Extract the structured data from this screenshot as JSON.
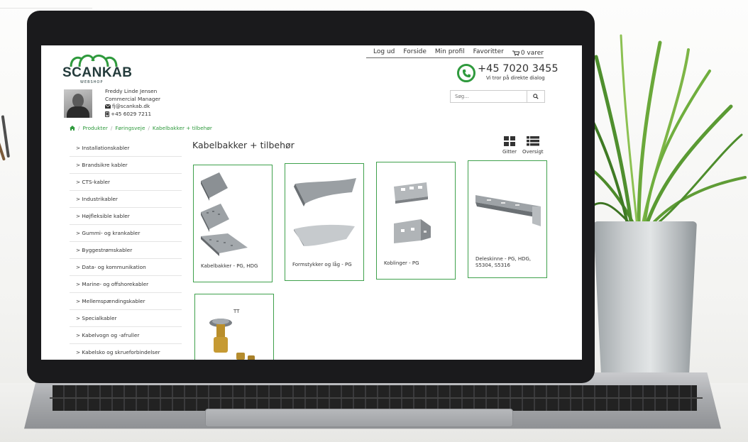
{
  "header": {
    "logo_text": "SCANKAB",
    "logo_sub": "WEBSHOP",
    "nav": [
      "Log ud",
      "Forside",
      "Min profil",
      "Favoritter",
      "0 varer"
    ],
    "phone": "+45 7020 3455",
    "phone_sub": "Vi tror på direkte dialog",
    "search_placeholder": "Søg..."
  },
  "contact": {
    "name": "Freddy Linde Jensen",
    "title": "Commercial Manager",
    "email": "fj@scankab.dk",
    "phone": "+45 6029 7211"
  },
  "breadcrumb": [
    "Produkter",
    "Føringsveje",
    "Kabelbakker + tilbehør"
  ],
  "sidebar": {
    "items": [
      "> Installationskabler",
      "> Brandsikre kabler",
      "> CTS-kabler",
      "> Industrikabler",
      "> Højfleksible kabler",
      "> Gummi- og krankabler",
      "> Byggestrømskabler",
      "> Data- og kommunikation",
      "> Marine- og offshorekabler",
      "> Mellemspændingskabler",
      "> Specialkabler",
      "> Kabelvogn og -afruller",
      "> Kabelsko og skrueforbindelser"
    ]
  },
  "main": {
    "title": "Kabelbakker + tilbehør",
    "view_grid": "Gitter",
    "view_list": "Oversigt",
    "products": [
      {
        "label": "Kabelbakker - PG, HDG"
      },
      {
        "label": "Formstykker og låg - PG"
      },
      {
        "label": "Koblinger - PG"
      },
      {
        "label": "Deleskinne - PG, HDG,",
        "label2": "S5304, S5316"
      }
    ]
  },
  "colors": {
    "accent": "#2f9a3d",
    "logo": "#233b3b"
  },
  "icons": [
    "phone-icon",
    "search-icon",
    "home-icon",
    "cart-icon",
    "envelope-icon",
    "mobile-icon",
    "grid-view-icon",
    "list-view-icon"
  ]
}
